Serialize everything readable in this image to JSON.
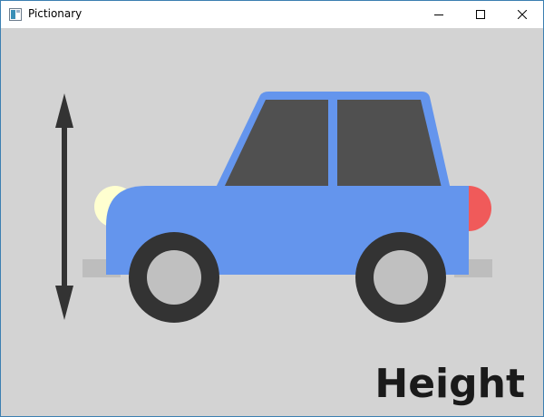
{
  "window": {
    "title": "Pictionary",
    "icon": "app-window-icon",
    "controls": {
      "minimize": "minimize-icon",
      "maximize": "maximize-icon",
      "close": "close-icon"
    }
  },
  "scene": {
    "subject": "car",
    "indicator": "vertical-double-arrow-icon",
    "caption": "Height"
  },
  "colors": {
    "canvas_background": "#d3d3d3",
    "car_body": "#6495ed",
    "windows": "#505050",
    "tires": "#333333",
    "hubcaps": "#c0c0c0",
    "headlight": "#ffffd0",
    "taillight": "#f05a5a",
    "bumpers": "#bdbdbd",
    "arrow": "#333333"
  }
}
